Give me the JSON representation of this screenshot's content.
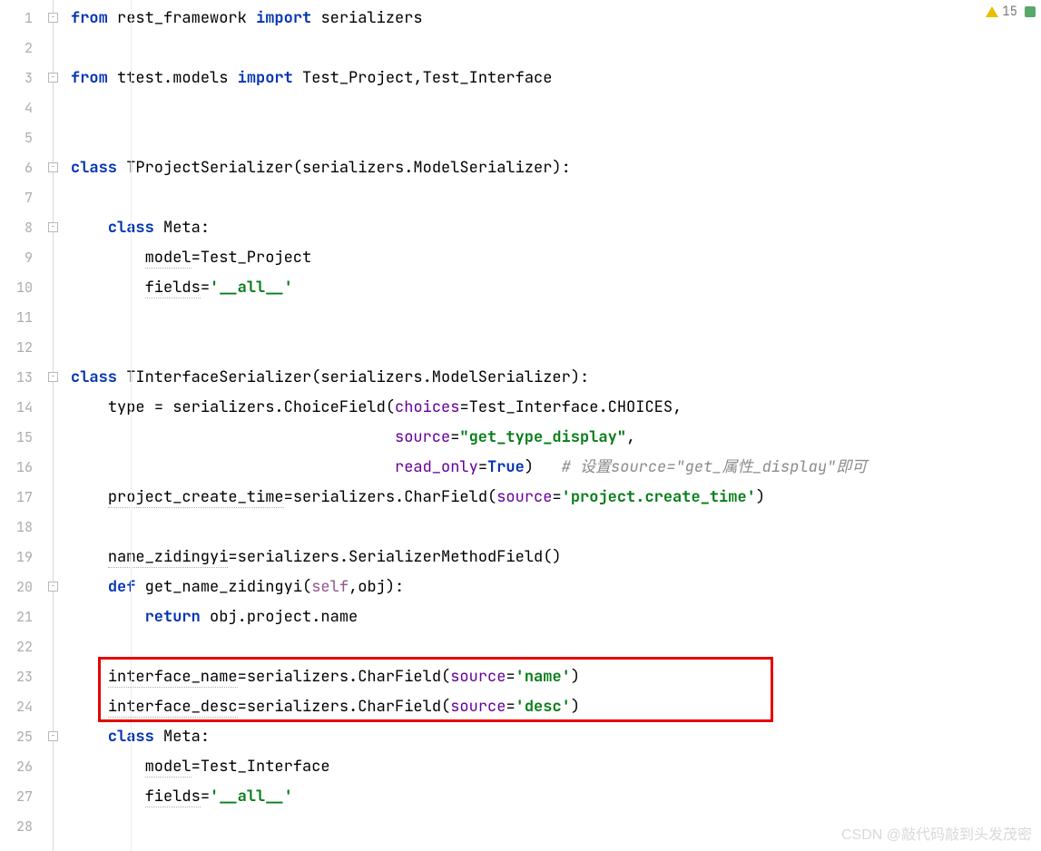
{
  "inspection": {
    "count": "15"
  },
  "watermark": "CSDN @敲代码敲到头发茂密",
  "lines": {
    "n1": "1",
    "n2": "2",
    "n3": "3",
    "n4": "4",
    "n5": "5",
    "n6": "6",
    "n7": "7",
    "n8": "8",
    "n9": "9",
    "n10": "10",
    "n11": "11",
    "n12": "12",
    "n13": "13",
    "n14": "14",
    "n15": "15",
    "n16": "16",
    "n17": "17",
    "n18": "18",
    "n19": "19",
    "n20": "20",
    "n21": "21",
    "n22": "22",
    "n23": "23",
    "n24": "24",
    "n25": "25",
    "n26": "26",
    "n27": "27",
    "n28": "28"
  },
  "code": {
    "l1": {
      "kw1": "from",
      "pkg": "rest_framework",
      "kw2": "import",
      "mod": "serializers"
    },
    "l3": {
      "kw1": "from",
      "pkg": "ttest.models",
      "kw2": "import",
      "names": "Test_Project,Test_Interface"
    },
    "l6": {
      "kw": "class",
      "name": "TProjectSerializer",
      "base": "serializers.ModelSerializer"
    },
    "l8": {
      "kw": "class",
      "name": "Meta"
    },
    "l9": {
      "lhs": "model",
      "rhs": "Test_Project"
    },
    "l10": {
      "lhs": "fields",
      "rhs": "'__all__'"
    },
    "l13": {
      "kw": "class",
      "name": "TInterfaceSerializer",
      "base": "serializers.ModelSerializer"
    },
    "l14": {
      "lhs": "type",
      "call": "serializers.ChoiceField",
      "arg": "choices",
      "val": "Test_Interface.CHOICES"
    },
    "l15": {
      "arg": "source",
      "val": "\"get_type_display\""
    },
    "l16": {
      "arg": "read_only",
      "val": "True",
      "comment": "# 设置source=\"get_属性_display\"即可"
    },
    "l17": {
      "lhs": "project_create_time",
      "call": "serializers.CharField",
      "arg": "source",
      "val": "'project.create_time'"
    },
    "l19": {
      "lhs": "name_zidingyi",
      "call": "serializers.SerializerMethodField"
    },
    "l20": {
      "kw": "def",
      "name": "get_name_zidingyi",
      "p1": "self",
      "p2": "obj"
    },
    "l21": {
      "kw": "return",
      "expr": "obj.project.name"
    },
    "l23": {
      "lhs": "interface_name",
      "call": "serializers.CharField",
      "arg": "source",
      "val": "'name'"
    },
    "l24": {
      "lhs": "interface_desc",
      "call": "serializers.CharField",
      "arg": "source",
      "val": "'desc'"
    },
    "l25": {
      "kw": "class",
      "name": "Meta"
    },
    "l26": {
      "lhs": "model",
      "rhs": "Test_Interface"
    },
    "l27": {
      "lhs": "fields",
      "rhs": "'__all__'"
    }
  }
}
